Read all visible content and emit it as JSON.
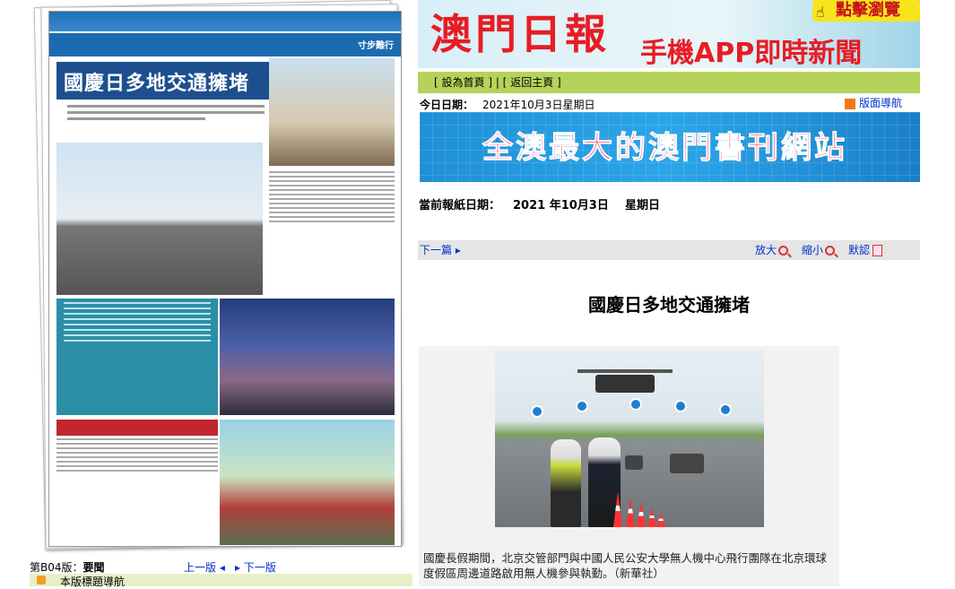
{
  "page_info": {
    "page_label": "第B04版：",
    "page_name": "要聞",
    "prev_page": "上一版",
    "next_page": "下一版",
    "headlines_nav": "本版標題導航"
  },
  "newspaper_thumb": {
    "headline": "國慶日多地交通擁堵",
    "section_tag": "寸步難行"
  },
  "banner": {
    "logo": "澳門日報",
    "app_text": "手機APP即時新聞",
    "click_label": "點擊瀏覽"
  },
  "nav": {
    "set_home": "設為首頁",
    "back_home": "返回主頁"
  },
  "today": {
    "label": "今日日期：",
    "value": "2021年10月3日星期日"
  },
  "layout_nav": "版面導航",
  "ad": {
    "text": "全澳最大的澳門書刊網站"
  },
  "current_date": {
    "label": "當前報紙日期：",
    "value": "2021 年10月3日",
    "weekday": "星期日"
  },
  "toolbar": {
    "next_article": "下一篇",
    "zoom_in": "放大",
    "zoom_out": "縮小",
    "zoom_default": "默認"
  },
  "article": {
    "title": "國慶日多地交通擁堵",
    "caption": "國慶長假期間，北京交管部門與中國人民公安大學無人機中心飛行團隊在北京環球度假區周邊道路啟用無人機參與執勤。（新華社）"
  }
}
